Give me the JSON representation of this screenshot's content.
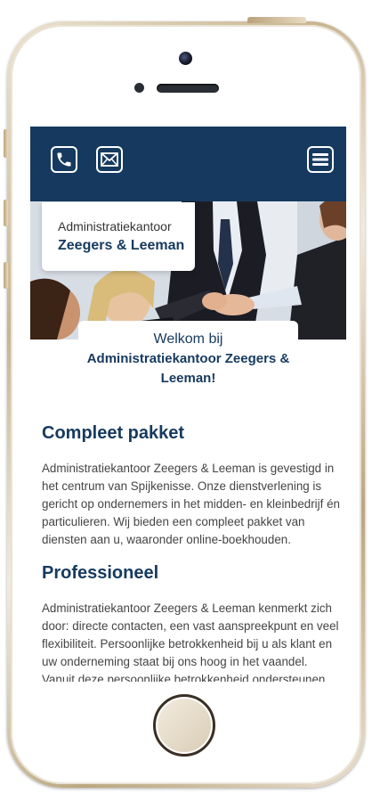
{
  "header": {
    "phone_icon": "phone-icon",
    "mail_icon": "mail-icon",
    "menu_icon": "menu-icon",
    "background": "#163a5f"
  },
  "logo": {
    "subtitle": "Administratiekantoor",
    "name": "Zeegers & Leeman"
  },
  "welcome": {
    "line1": "Welkom bij",
    "line2": "Administratiekantoor Zeegers & Leeman!"
  },
  "sections": [
    {
      "title": "Compleet pakket",
      "body": "Administratiekantoor Zeegers & Leeman is gevestigd in het centrum van Spijkenisse. Onze dienstverlening is gericht op ondernemers in het midden- en kleinbedrijf én particulieren. Wij bieden een compleet pakket van diensten aan u, waaronder online-boekhouden."
    },
    {
      "title": "Professioneel",
      "body": "Administratiekantoor Zeegers & Leeman kenmerkt zich door: directe contacten, een vast aanspreekpunt en veel flexibiliteit. Persoonlijke betrokkenheid bij u als klant en uw onderneming staat bij ons hoog in het vaandel. Vanuit deze persoonlijke betrokkenheid ondersteunen"
    }
  ]
}
